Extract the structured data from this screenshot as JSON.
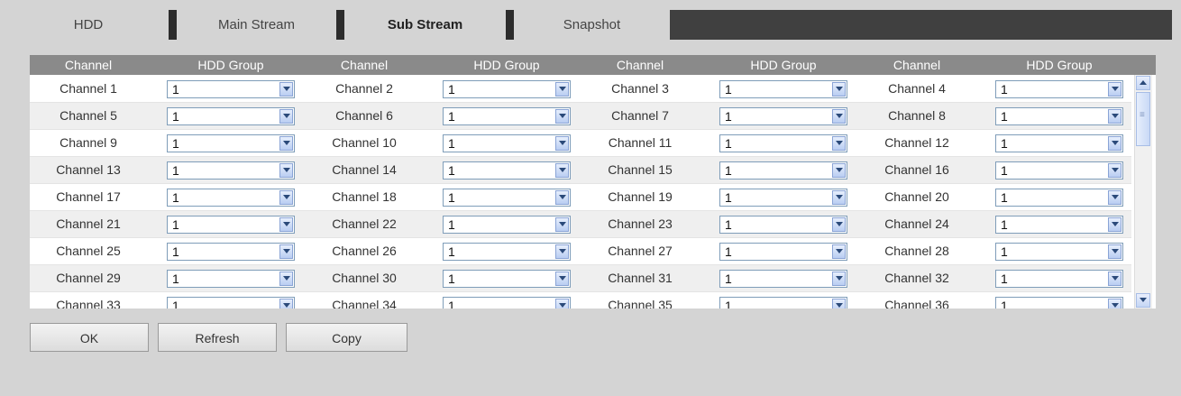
{
  "tabs": [
    {
      "label": "HDD",
      "active": false
    },
    {
      "label": "Main Stream",
      "active": false
    },
    {
      "label": "Sub Stream",
      "active": true
    },
    {
      "label": "Snapshot",
      "active": false
    }
  ],
  "table": {
    "headers": [
      "Channel",
      "HDD Group",
      "Channel",
      "HDD Group",
      "Channel",
      "HDD Group",
      "Channel",
      "HDD Group"
    ],
    "rows": [
      [
        {
          "channel": "Channel 1",
          "group": "1"
        },
        {
          "channel": "Channel 2",
          "group": "1"
        },
        {
          "channel": "Channel 3",
          "group": "1"
        },
        {
          "channel": "Channel 4",
          "group": "1"
        }
      ],
      [
        {
          "channel": "Channel 5",
          "group": "1"
        },
        {
          "channel": "Channel 6",
          "group": "1"
        },
        {
          "channel": "Channel 7",
          "group": "1"
        },
        {
          "channel": "Channel 8",
          "group": "1"
        }
      ],
      [
        {
          "channel": "Channel 9",
          "group": "1"
        },
        {
          "channel": "Channel 10",
          "group": "1"
        },
        {
          "channel": "Channel 11",
          "group": "1"
        },
        {
          "channel": "Channel 12",
          "group": "1"
        }
      ],
      [
        {
          "channel": "Channel 13",
          "group": "1"
        },
        {
          "channel": "Channel 14",
          "group": "1"
        },
        {
          "channel": "Channel 15",
          "group": "1"
        },
        {
          "channel": "Channel 16",
          "group": "1"
        }
      ],
      [
        {
          "channel": "Channel 17",
          "group": "1"
        },
        {
          "channel": "Channel 18",
          "group": "1"
        },
        {
          "channel": "Channel 19",
          "group": "1"
        },
        {
          "channel": "Channel 20",
          "group": "1"
        }
      ],
      [
        {
          "channel": "Channel 21",
          "group": "1"
        },
        {
          "channel": "Channel 22",
          "group": "1"
        },
        {
          "channel": "Channel 23",
          "group": "1"
        },
        {
          "channel": "Channel 24",
          "group": "1"
        }
      ],
      [
        {
          "channel": "Channel 25",
          "group": "1"
        },
        {
          "channel": "Channel 26",
          "group": "1"
        },
        {
          "channel": "Channel 27",
          "group": "1"
        },
        {
          "channel": "Channel 28",
          "group": "1"
        }
      ],
      [
        {
          "channel": "Channel 29",
          "group": "1"
        },
        {
          "channel": "Channel 30",
          "group": "1"
        },
        {
          "channel": "Channel 31",
          "group": "1"
        },
        {
          "channel": "Channel 32",
          "group": "1"
        }
      ],
      [
        {
          "channel": "Channel 33",
          "group": "1"
        },
        {
          "channel": "Channel 34",
          "group": "1"
        },
        {
          "channel": "Channel 35",
          "group": "1"
        },
        {
          "channel": "Channel 36",
          "group": "1"
        }
      ]
    ]
  },
  "buttons": {
    "ok": "OK",
    "refresh": "Refresh",
    "copy": "Copy"
  },
  "colors": {
    "tab_bar": "#404040",
    "header_bg": "#8a8a8a",
    "page_bg": "#d4d4d4"
  }
}
